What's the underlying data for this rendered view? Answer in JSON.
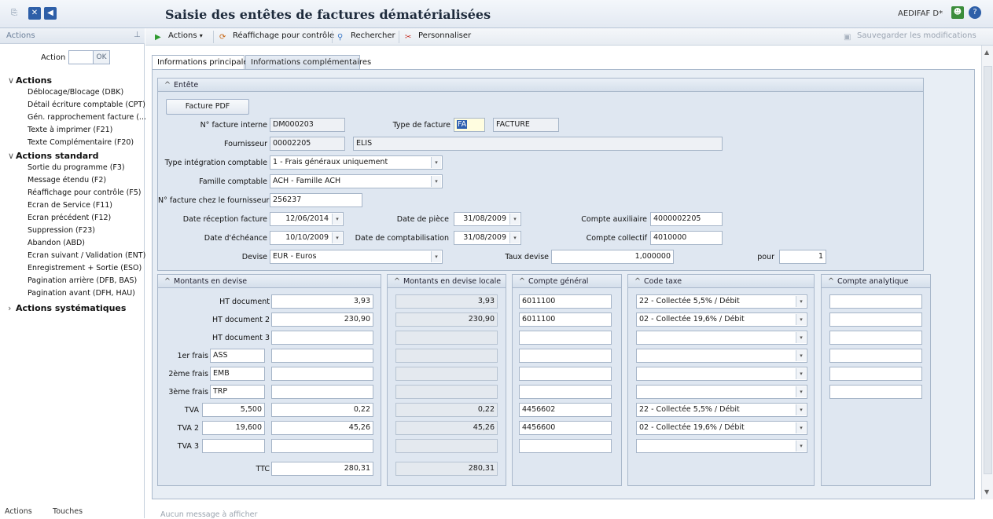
{
  "window": {
    "title": "Saisie des entêtes de factures dématérialisées",
    "user": "AEDIFAF D*"
  },
  "sidebar": {
    "title": "Actions",
    "action_label": "Action",
    "ok_label": "OK",
    "groups": [
      {
        "label": "Actions",
        "items": [
          "Déblocage/Blocage (DBK)",
          "Détail écriture comptable (CPT)",
          "Gén. rapprochement facture (...",
          "Texte à imprimer (F21)",
          "Texte Complémentaire (F20)"
        ]
      },
      {
        "label": "Actions standard",
        "items": [
          "Sortie du programme (F3)",
          "Message étendu (F2)",
          "Réaffichage pour contrôle (F5)",
          "Ecran de Service (F11)",
          "Ecran précédent (F12)",
          "Suppression (F23)",
          "Abandon (ABD)",
          "Ecran suivant / Validation (ENT)",
          "Enregistrement + Sortie (ESO)",
          "Pagination arrière (DFB, BAS)",
          "Pagination avant (DFH, HAU)"
        ]
      },
      {
        "label": "Actions systématiques",
        "items": []
      }
    ],
    "footer_tabs": [
      "Actions",
      "Touches"
    ]
  },
  "toolbar": {
    "actions": "Actions",
    "refresh": "Réaffichage pour contrôle",
    "search": "Rechercher",
    "customize": "Personnaliser",
    "save": "Sauvegarder les modifications"
  },
  "tabs": [
    "Informations principales",
    "Informations complémentaires"
  ],
  "header": {
    "title": "Entête",
    "pdf_button": "Facture PDF",
    "invoice_internal_label": "N° facture interne",
    "invoice_internal": "DM000203",
    "invoice_type_label": "Type de facture",
    "invoice_type_code": "FA",
    "invoice_type_name": "FACTURE",
    "supplier_label": "Fournisseur",
    "supplier_code": "00002205",
    "supplier_name": "ELIS",
    "integration_label": "Type intégration comptable",
    "integration": "1 - Frais généraux uniquement",
    "family_label": "Famille comptable",
    "family": "ACH - Famille ACH",
    "supplier_invoice_label": "N° facture chez le fournisseur",
    "supplier_invoice": "256237",
    "reception_label": "Date réception facture",
    "reception": "12/06/2014",
    "piece_date_label": "Date de pièce",
    "piece_date": "31/08/2009",
    "aux_account_label": "Compte auxiliaire",
    "aux_account": "4000002205",
    "due_label": "Date d'échéance",
    "due": "10/10/2009",
    "accounting_date_label": "Date de comptabilisation",
    "accounting_date": "31/08/2009",
    "collective_label": "Compte collectif",
    "collective": "4010000",
    "currency_label": "Devise",
    "currency": "EUR - Euros",
    "rate_label": "Taux devise",
    "rate": "1,000000",
    "pour_label": "pour",
    "pour": "1"
  },
  "amounts": {
    "titles": {
      "currency": "Montants en devise",
      "local": "Montants en devise locale",
      "general": "Compte général",
      "tax": "Code taxe",
      "analytic": "Compte analytique"
    },
    "rows": [
      {
        "label": "HT document",
        "code": "",
        "rate": "",
        "amount": "3,93",
        "local": "3,93",
        "account": "6011100",
        "tax": "22 - Collectée  5,5% / Débit"
      },
      {
        "label": "HT document 2",
        "code": "",
        "rate": "",
        "amount": "230,90",
        "local": "230,90",
        "account": "6011100",
        "tax": "02 - Collectée 19,6% / Débit"
      },
      {
        "label": "HT document 3",
        "code": "",
        "rate": "",
        "amount": "",
        "local": "",
        "account": "",
        "tax": ""
      },
      {
        "label": "1er frais",
        "code": "ASS",
        "rate": "",
        "amount": "",
        "local": "",
        "account": "",
        "tax": ""
      },
      {
        "label": "2ème frais",
        "code": "EMB",
        "rate": "",
        "amount": "",
        "local": "",
        "account": "",
        "tax": ""
      },
      {
        "label": "3ème frais",
        "code": "TRP",
        "rate": "",
        "amount": "",
        "local": "",
        "account": "",
        "tax": ""
      },
      {
        "label": "TVA",
        "code": "",
        "rate": "5,500",
        "amount": "0,22",
        "local": "0,22",
        "account": "4456602",
        "tax": "22 - Collectée  5,5% / Débit"
      },
      {
        "label": "TVA 2",
        "code": "",
        "rate": "19,600",
        "amount": "45,26",
        "local": "45,26",
        "account": "4456600",
        "tax": "02 - Collectée 19,6% / Débit"
      },
      {
        "label": "TVA 3",
        "code": "",
        "rate": "",
        "amount": "",
        "local": "",
        "account": "",
        "tax": ""
      }
    ],
    "ttc_label": "TTC",
    "ttc": "280,31",
    "ttc_local": "280,31"
  },
  "status": {
    "message": "Aucun message à afficher"
  },
  "colors": {
    "accent": "#2d5fb0",
    "panel": "#dfe7f1",
    "border": "#a9b8cb"
  }
}
